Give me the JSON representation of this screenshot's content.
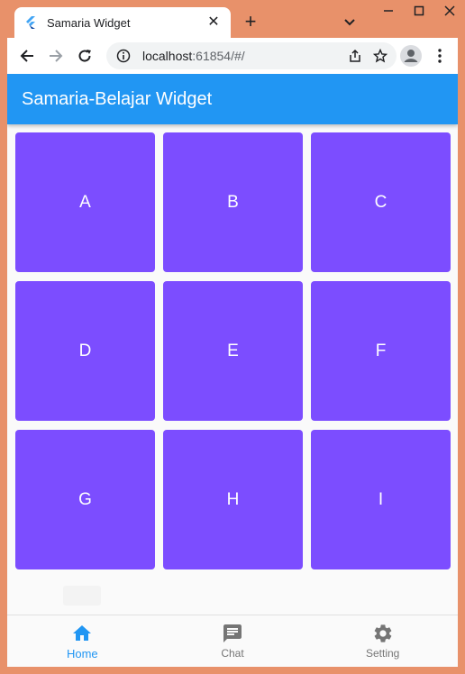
{
  "browser": {
    "tab_title": "Samaria Widget",
    "tab_close": "✕",
    "new_tab": "+",
    "url_host": "localhost",
    "url_rest": ":61854/#/"
  },
  "app": {
    "title": "Samaria-Belajar Widget",
    "primary_color": "#2196f3",
    "tile_color": "#7c4dff",
    "tiles": [
      "A",
      "B",
      "C",
      "D",
      "E",
      "F",
      "G",
      "H",
      "I"
    ]
  },
  "bottom_nav": {
    "items": [
      {
        "label": "Home",
        "icon": "home-icon",
        "active": true
      },
      {
        "label": "Chat",
        "icon": "chat-icon",
        "active": false
      },
      {
        "label": "Setting",
        "icon": "gear-icon",
        "active": false
      }
    ]
  }
}
